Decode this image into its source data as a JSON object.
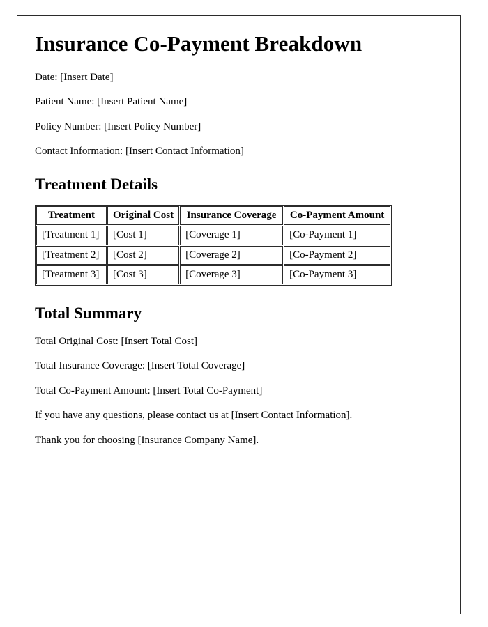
{
  "document": {
    "title": "Insurance Co-Payment Breakdown",
    "meta_lines": [
      "Date: [Insert Date]",
      "Patient Name: [Insert Patient Name]",
      "Policy Number: [Insert Policy Number]",
      "Contact Information: [Insert Contact Information]"
    ],
    "treatment_section": {
      "heading": "Treatment Details",
      "table": {
        "columns": [
          "Treatment",
          "Original Cost",
          "Insurance Coverage",
          "Co-Payment Amount"
        ],
        "rows": [
          [
            "[Treatment 1]",
            "[Cost 1]",
            "[Coverage 1]",
            "[Co-Payment 1]"
          ],
          [
            "[Treatment 2]",
            "[Cost 2]",
            "[Coverage 2]",
            "[Co-Payment 2]"
          ],
          [
            "[Treatment 3]",
            "[Cost 3]",
            "[Coverage 3]",
            "[Co-Payment 3]"
          ]
        ]
      }
    },
    "summary_section": {
      "heading": "Total Summary",
      "lines": [
        "Total Original Cost: [Insert Total Cost]",
        "Total Insurance Coverage: [Insert Total Coverage]",
        "Total Co-Payment Amount: [Insert Total Co-Payment]",
        "If you have any questions, please contact us at [Insert Contact Information].",
        "Thank you for choosing [Insurance Company Name]."
      ]
    }
  }
}
